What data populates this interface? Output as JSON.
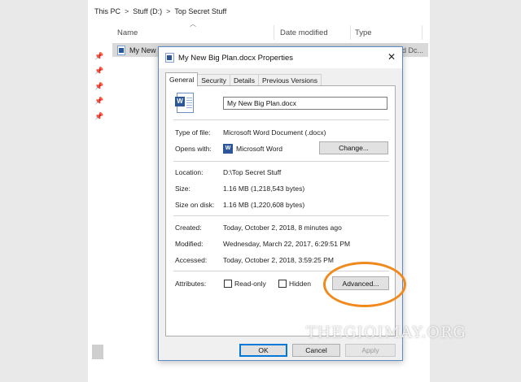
{
  "breadcrumb": {
    "items": [
      "This PC",
      "Stuff (D:)",
      "Top Secret Stuff"
    ],
    "separator": ">"
  },
  "columns": {
    "name": "Name",
    "date_modified": "Date modified",
    "type": "Type"
  },
  "file_row": {
    "name": "My New",
    "date_fragment": "d Dc..."
  },
  "dialog": {
    "title": "My New Big Plan.docx Properties",
    "close_glyph": "✕",
    "tabs": [
      "General",
      "Security",
      "Details",
      "Previous Versions"
    ],
    "active_tab": "General",
    "file_name": "My New Big Plan.docx",
    "type_of_file": {
      "label": "Type of file:",
      "value": "Microsoft Word Document (.docx)"
    },
    "opens_with": {
      "label": "Opens with:",
      "value": "Microsoft Word",
      "button": "Change..."
    },
    "location": {
      "label": "Location:",
      "value": "D:\\Top Secret Stuff"
    },
    "size": {
      "label": "Size:",
      "value": "1.16 MB (1,218,543 bytes)"
    },
    "size_on_disk": {
      "label": "Size on disk:",
      "value": "1.16 MB (1,220,608 bytes)"
    },
    "created": {
      "label": "Created:",
      "value": "Today, October 2, 2018, 8 minutes ago"
    },
    "modified": {
      "label": "Modified:",
      "value": "Wednesday, March 22, 2017, 6:29:51 PM"
    },
    "accessed": {
      "label": "Accessed:",
      "value": "Today, October 2, 2018, 3:59:25 PM"
    },
    "attributes": {
      "label": "Attributes:",
      "read_only": "Read-only",
      "hidden": "Hidden",
      "advanced_button": "Advanced..."
    },
    "buttons": {
      "ok": "OK",
      "cancel": "Cancel",
      "apply": "Apply"
    }
  },
  "watermark": "THEGIOIMAY.ORG",
  "colors": {
    "accent": "#0078d7",
    "highlight_ring": "#f08a1d",
    "word_blue": "#2b579a"
  }
}
